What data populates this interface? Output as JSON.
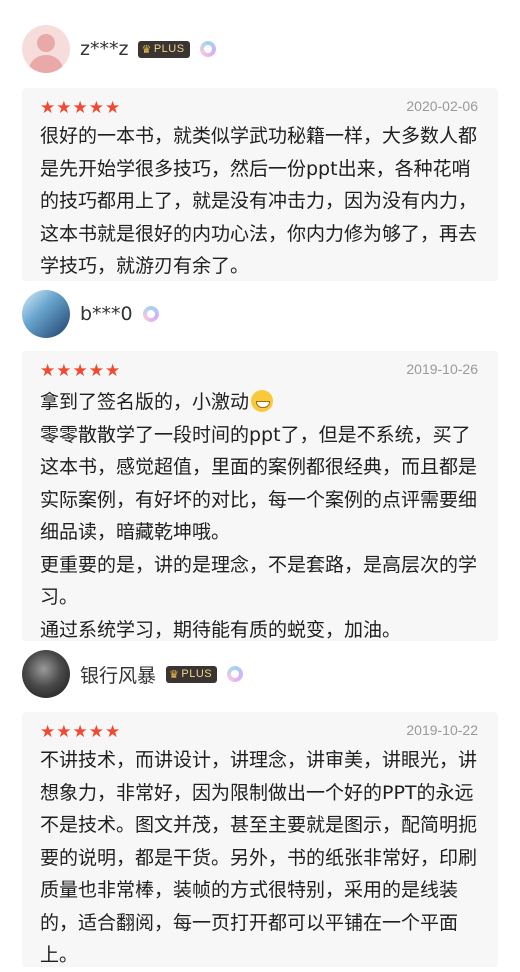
{
  "reviews": [
    {
      "username": "z***z",
      "plus": true,
      "stars": "★★★★★",
      "date": "2020-02-06",
      "lines": [
        "很好的一本书，就类似学武功秘籍一样，大多数人都是先开始学很多技巧，然后一份ppt出来，各种花哨的技巧都用上了，就是没有冲击力，因为没有内力，这本书就是很好的内功心法，你内力修为够了，再去学技巧，就游刃有余了。"
      ]
    },
    {
      "username": "b***0",
      "plus": false,
      "stars": "★★★★★",
      "date": "2019-10-26",
      "lines": [
        "拿到了签名版的，小激动",
        "零零散散学了一段时间的ppt了，但是不系统，买了这本书，感觉超值，里面的案例都很经典，而且都是实际案例，有好坏的对比，每一个案例的点评需要细细品读，暗藏乾坤哦。",
        "更重要的是，讲的是理念，不是套路，是高层次的学习。",
        "通过系统学习，期待能有质的蜕变，加油。"
      ]
    },
    {
      "username": "银行风暴",
      "plus": true,
      "stars": "★★★★★",
      "date": "2019-10-22",
      "lines": [
        "不讲技术，而讲设计，讲理念，讲审美，讲眼光，讲想象力，非常好，因为限制做出一个好的PPT的永远不是技术。图文并茂，甚至主要就是图示，配简明扼要的说明，都是干货。另外，书的纸张非常好，印刷质量也非常棒，装帧的方式很特别，采用的是线装的，适合翻阅，每一页打开都可以平铺在一个平面上。"
      ]
    }
  ],
  "plus_label": "PLUS",
  "crown_glyph": "♛"
}
